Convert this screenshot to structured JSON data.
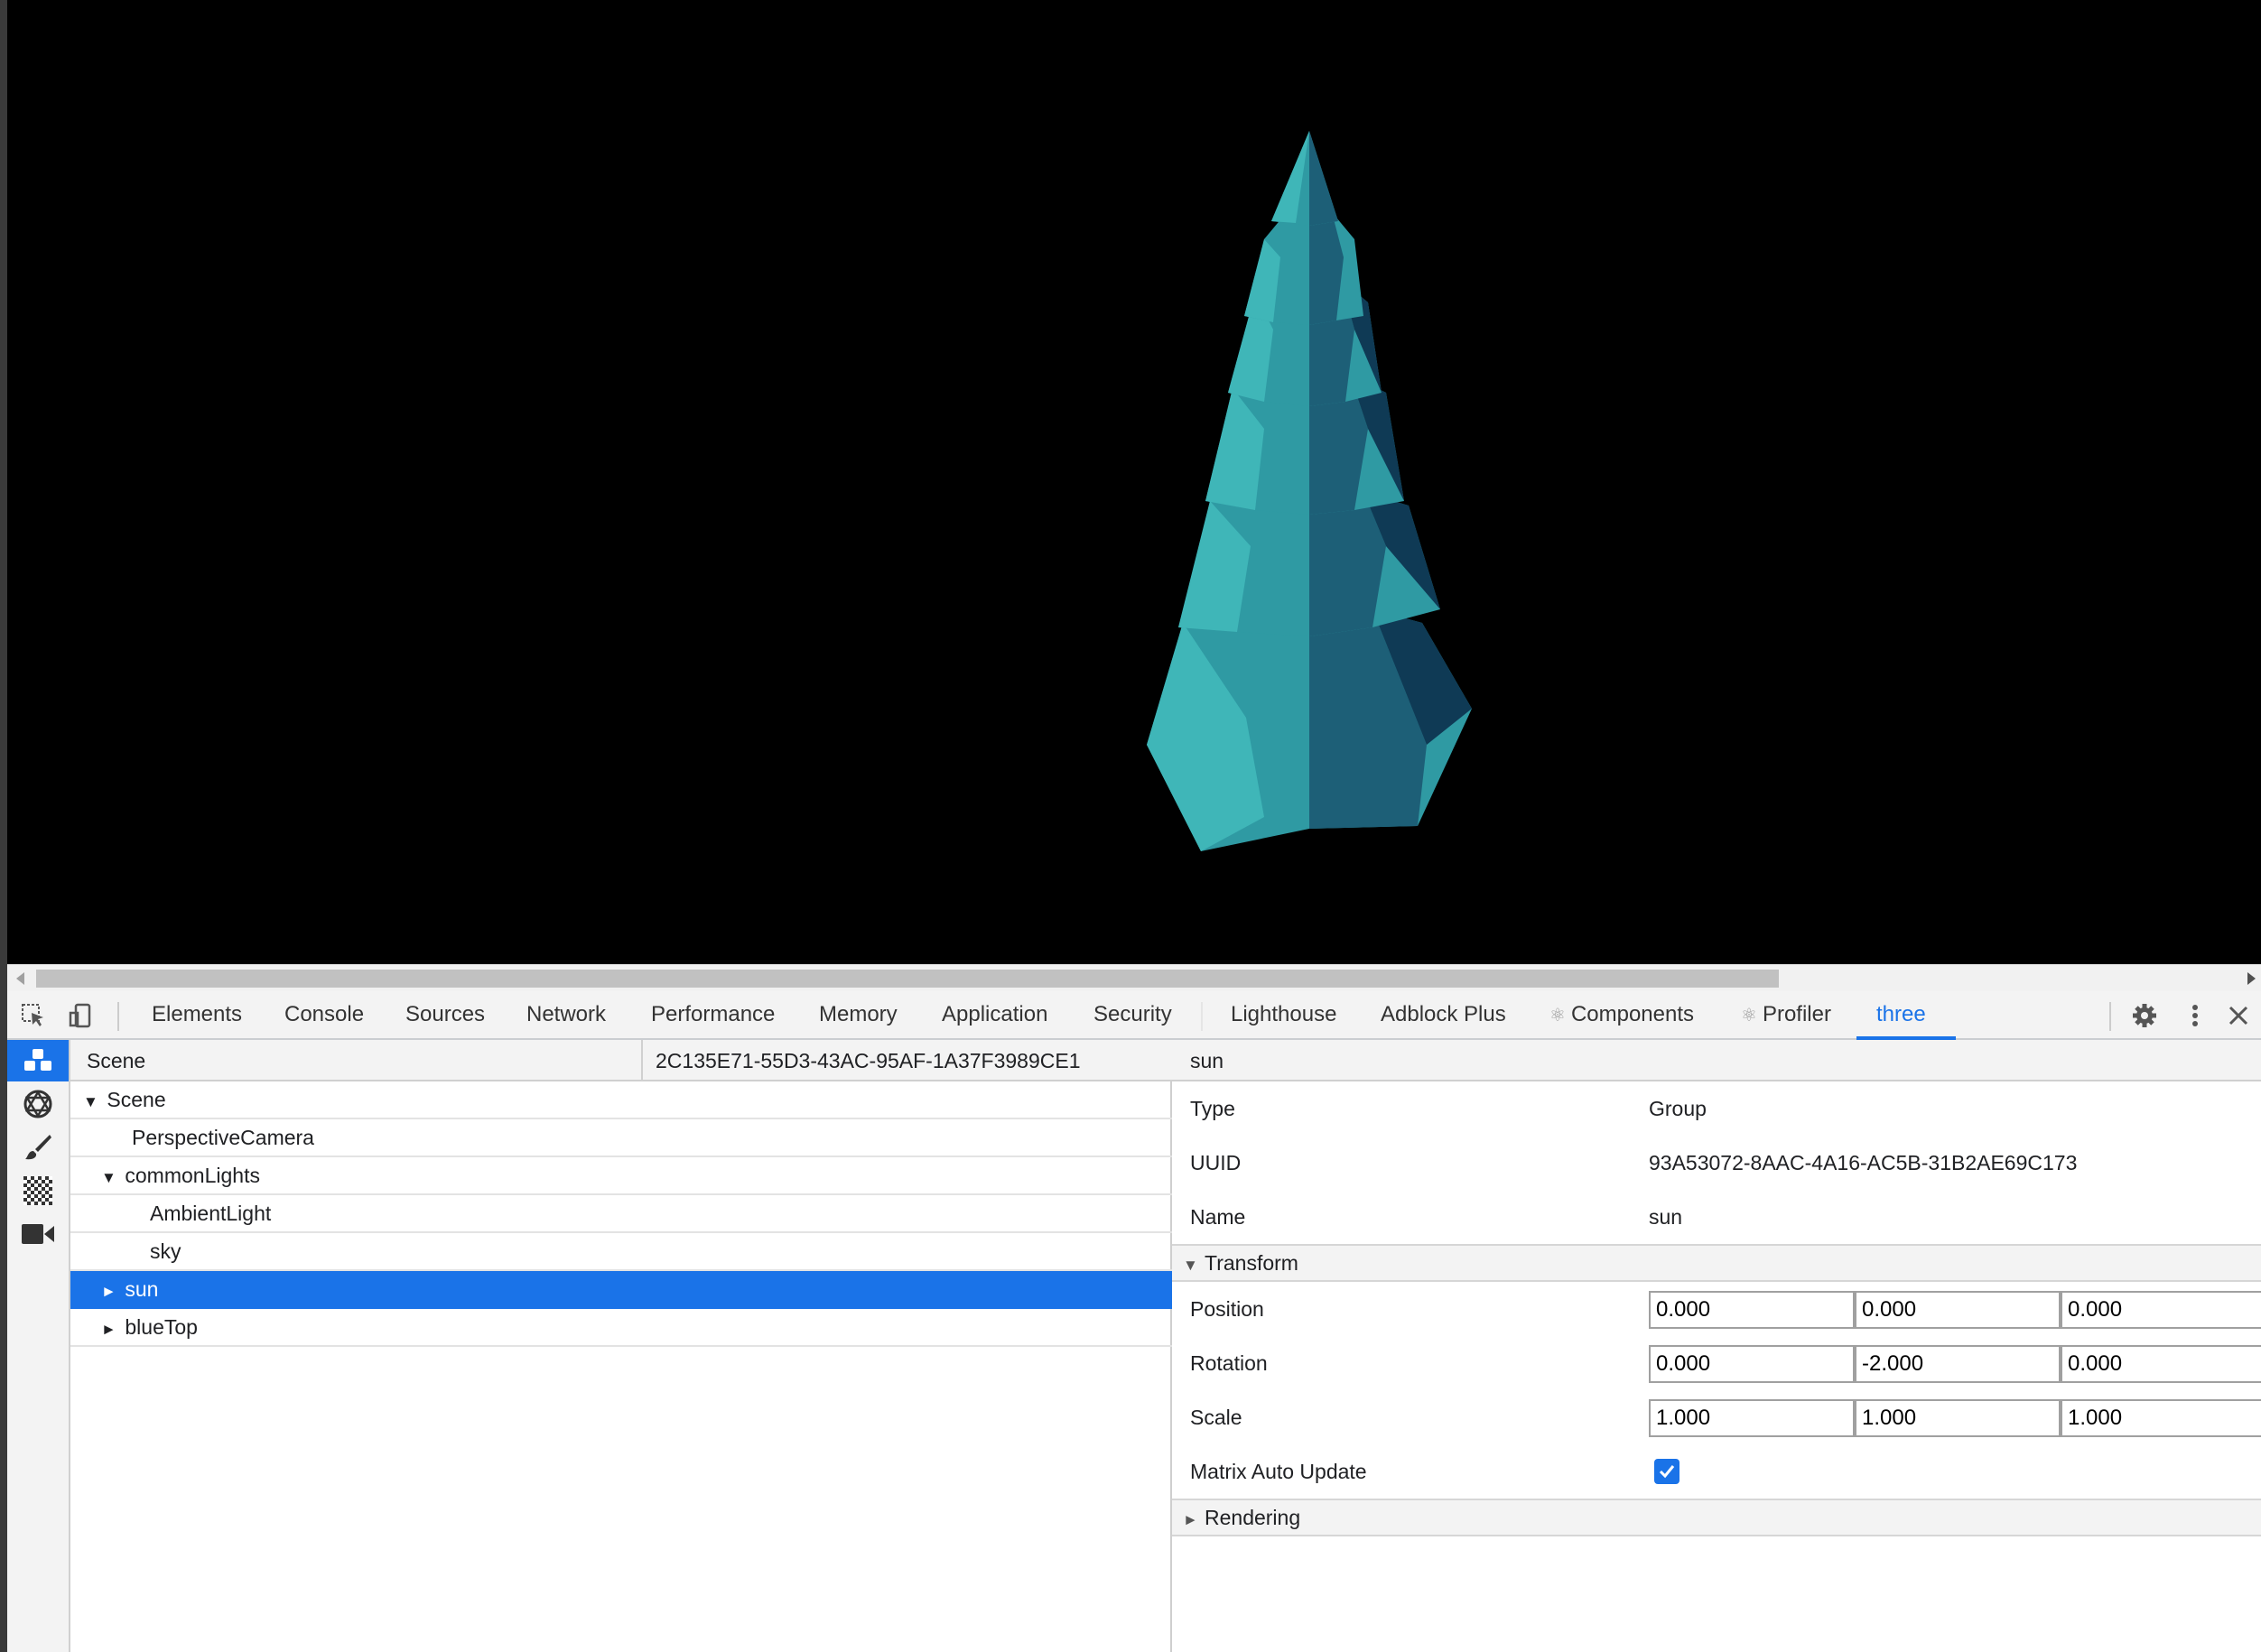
{
  "toolbar": {
    "tabs": [
      "Elements",
      "Console",
      "Sources",
      "Network",
      "Performance",
      "Memory",
      "Application",
      "Security",
      "Lighthouse",
      "Adblock Plus",
      "Components",
      "Profiler",
      "three"
    ],
    "active_tab": "three"
  },
  "scene_panel": {
    "header_label": "Scene",
    "selected_scene_uuid": "2C135E71-55D3-43AC-95AF-1A37F3989CE1",
    "tree": [
      {
        "label": "Scene",
        "expanded": "▼"
      },
      {
        "label": "PerspectiveCamera",
        "expanded": ""
      },
      {
        "label": "commonLights",
        "expanded": "▼"
      },
      {
        "label": "AmbientLight",
        "expanded": ""
      },
      {
        "label": "sky",
        "expanded": ""
      },
      {
        "label": "sun",
        "expanded": "►"
      },
      {
        "label": "blueTop",
        "expanded": "►"
      }
    ]
  },
  "properties": {
    "header": "sun",
    "type_label": "Type",
    "type_value": "Group",
    "uuid_label": "UUID",
    "uuid_value": "93A53072-8AAC-4A16-AC5B-31B2AE69C173",
    "name_label": "Name",
    "name_value": "sun",
    "transform_label": "Transform",
    "position_label": "Position",
    "position": [
      "0.000",
      "0.000",
      "0.000"
    ],
    "rotation_label": "Rotation",
    "rotation": [
      "0.000",
      "-2.000",
      "0.000"
    ],
    "scale_label": "Scale",
    "scale": [
      "1.000",
      "1.000",
      "1.000"
    ],
    "matrix_auto_update_label": "Matrix Auto Update",
    "matrix_auto_update": true,
    "rendering_label": "Rendering"
  },
  "colors": {
    "accent": "#1a73e8",
    "tree_light": "#3fb6b8",
    "tree_mid": "#2a8e97",
    "tree_dark": "#0f3a55"
  }
}
